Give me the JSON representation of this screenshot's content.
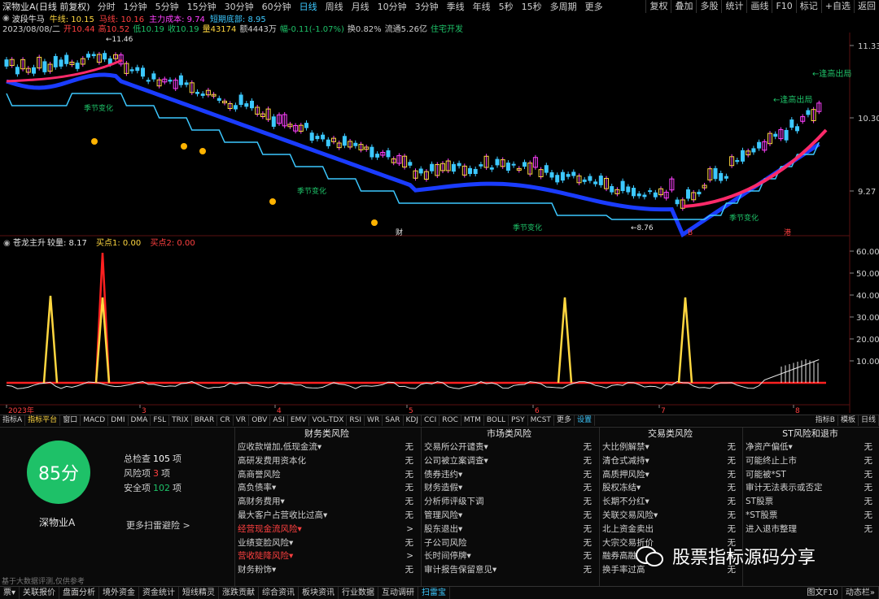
{
  "header": {
    "title": "深物业A(日线 前复权)",
    "periods": [
      "分时",
      "1分钟",
      "5分钟",
      "15分钟",
      "30分钟",
      "60分钟",
      "日线",
      "周线",
      "月线",
      "10分钟",
      "3分钟",
      "季线",
      "年线",
      "5秒",
      "15秒",
      "多周期",
      "更多"
    ],
    "active_period": "日线",
    "right_tools": [
      "复权",
      "叠加",
      "多股",
      "统计",
      "画线",
      "F10",
      "标记",
      "+自选",
      "返回"
    ]
  },
  "ma_line": [
    {
      "text": "波段牛马",
      "color": "#e6e6e6"
    },
    {
      "text": "牛线: 10.15",
      "color": "#ffd740"
    },
    {
      "text": "马线: 10.16",
      "color": "#ff4040"
    },
    {
      "text": "主力成本: 9.74",
      "color": "#ff40ff"
    },
    {
      "text": "短期底部: 8.95",
      "color": "#3cc8ff"
    }
  ],
  "info_line": [
    {
      "text": "2023/08/08/二",
      "color": "#cfcfcf"
    },
    {
      "text": "开10.44",
      "color": "#ff4040"
    },
    {
      "text": "高10.52",
      "color": "#ff4040"
    },
    {
      "text": "低10.19",
      "color": "#1ec168"
    },
    {
      "text": "收10.19",
      "color": "#1ec168"
    },
    {
      "text": "量43174",
      "color": "#ffd740"
    },
    {
      "text": "额4443万",
      "color": "#cfcfcf"
    },
    {
      "text": "幅-0.11(-1.07%)",
      "color": "#1ec168"
    },
    {
      "text": "换0.82%",
      "color": "#cfcfcf"
    },
    {
      "text": "流通5.26亿",
      "color": "#cfcfcf"
    },
    {
      "text": "住宅开发",
      "color": "#1ec168"
    }
  ],
  "price_axis": [
    "11.33",
    "10.30",
    "9.27"
  ],
  "price_annotations": {
    "high": "11.46",
    "low": "8.76",
    "events": [
      "季节变化",
      "季节变化",
      "季节变化",
      "季节变化"
    ],
    "escape": [
      "←逢高出局",
      "←逢高出局"
    ],
    "marks": [
      "财",
      "B",
      "港"
    ]
  },
  "indicator": {
    "name": "苍龙主升",
    "values": [
      {
        "text": "较量: 8.17",
        "color": "#e6e6e6"
      },
      {
        "text": "买点1: 0.00",
        "color": "#ffd740"
      },
      {
        "text": "买点2: 0.00",
        "color": "#ff4040"
      }
    ],
    "axis": [
      "60.00",
      "50.00",
      "40.00",
      "30.00",
      "20.00",
      "10.00"
    ]
  },
  "date_axis": [
    "2023年",
    "3",
    "4",
    "5",
    "6",
    "7",
    "8"
  ],
  "tabs": [
    "指标A",
    "指标平台",
    "窗口",
    "MACD",
    "DMI",
    "DMA",
    "FSL",
    "TRIX",
    "BRAR",
    "CR",
    "VR",
    "OBV",
    "ASI",
    "EMV",
    "VOL-TDX",
    "RSI",
    "WR",
    "SAR",
    "KDJ",
    "CCI",
    "ROC",
    "MTM",
    "BOLL",
    "PSY",
    "MCST",
    "更多",
    "设置"
  ],
  "tabs_right": [
    "指标B",
    "模板",
    "日线"
  ],
  "score": {
    "value": "85分",
    "stock": "深物业A",
    "total_label": "总检查",
    "total": "105",
    "unit": "项",
    "risk_label": "风险项",
    "risk": "3",
    "safe_label": "安全项",
    "safe": "102",
    "more": "更多扫雷避险 >"
  },
  "risk_columns": [
    {
      "title": "财务类风险",
      "rows": [
        {
          "label": "应收款增加,低现金流▾",
          "value": "无",
          "hl": false
        },
        {
          "label": "高研发费用资本化",
          "value": "无",
          "hl": false
        },
        {
          "label": "高商誉风险",
          "value": "无",
          "hl": false
        },
        {
          "label": "高负债率▾",
          "value": "无",
          "hl": false
        },
        {
          "label": "高财务费用▾",
          "value": "无",
          "hl": false
        },
        {
          "label": "最大客户占营收比过高▾",
          "value": "无",
          "hl": false
        },
        {
          "label": "经营现金流风险▾",
          "value": ">",
          "hl": true
        },
        {
          "label": "业绩变脸风险▾",
          "value": "无",
          "hl": false
        },
        {
          "label": "营收陡降风险▾",
          "value": ">",
          "hl": true
        },
        {
          "label": "财务粉饰▾",
          "value": "无",
          "hl": false
        }
      ]
    },
    {
      "title": "市场类风险",
      "rows": [
        {
          "label": "交易所公开谴责▾",
          "value": "无",
          "hl": false
        },
        {
          "label": "公司被立案调查▾",
          "value": "无",
          "hl": false
        },
        {
          "label": "债券违约▾",
          "value": "无",
          "hl": false
        },
        {
          "label": "财务造假▾",
          "value": "无",
          "hl": false
        },
        {
          "label": "分析师评级下调",
          "value": "无",
          "hl": false
        },
        {
          "label": "管理风险▾",
          "value": "无",
          "hl": false
        },
        {
          "label": "股东退出▾",
          "value": "无",
          "hl": false
        },
        {
          "label": "子公司风险",
          "value": "无",
          "hl": false
        },
        {
          "label": "长时间停牌▾",
          "value": "无",
          "hl": false
        },
        {
          "label": "审计报告保留意见▾",
          "value": "无",
          "hl": false
        }
      ]
    },
    {
      "title": "交易类风险",
      "rows": [
        {
          "label": "大比例解禁▾",
          "value": "无",
          "hl": false
        },
        {
          "label": "清仓式减持▾",
          "value": "无",
          "hl": false
        },
        {
          "label": "高质押风险▾",
          "value": "无",
          "hl": false
        },
        {
          "label": "股权冻结▾",
          "value": "无",
          "hl": false
        },
        {
          "label": "长期不分红▾",
          "value": "无",
          "hl": false
        },
        {
          "label": "关联交易风险▾",
          "value": "无",
          "hl": false
        },
        {
          "label": "北上资金卖出",
          "value": "无",
          "hl": false
        },
        {
          "label": "大宗交易折价",
          "value": "无",
          "hl": false
        },
        {
          "label": "融券高融",
          "value": "无",
          "hl": false
        },
        {
          "label": "换手率过高",
          "value": "无",
          "hl": false
        }
      ]
    },
    {
      "title": "ST风险和退市",
      "rows": [
        {
          "label": "净资产偏低▾",
          "value": "无",
          "hl": false
        },
        {
          "label": "可能终止上市",
          "value": "无",
          "hl": false
        },
        {
          "label": "可能被*ST",
          "value": "无",
          "hl": false
        },
        {
          "label": "审计无法表示或否定",
          "value": "无",
          "hl": false
        },
        {
          "label": "ST股票",
          "value": "无",
          "hl": false
        },
        {
          "label": "*ST股票",
          "value": "无",
          "hl": false
        },
        {
          "label": "进入退市整理",
          "value": "无",
          "hl": false
        }
      ]
    }
  ],
  "footnote": "基于大数据评测,仅供参考",
  "watermark": "股票指标源码分享",
  "bottom_tabs": [
    "票▾",
    "关联报价",
    "盘面分析",
    "境外资金",
    "资金统计",
    "短线精灵",
    "涨跌贡献",
    "综合资讯",
    "板块资讯",
    "行业数据",
    "互动调研",
    "扫雷宝"
  ],
  "bottom_right": [
    "图文F10",
    "动态栏»"
  ]
}
